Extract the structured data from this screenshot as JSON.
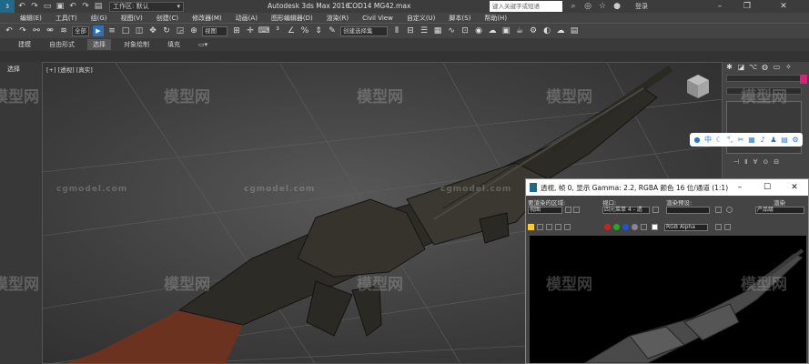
{
  "titlebar": {
    "workspace_label": "工作区: 默认",
    "app_title": "Autodesk 3ds Max 2016",
    "file_title": "COD14 MG42.max",
    "search_placeholder": "键入关键字或短语",
    "login": "登录"
  },
  "menu": [
    "编辑(E)",
    "工具(T)",
    "组(G)",
    "视图(V)",
    "创建(C)",
    "修改器(M)",
    "动画(A)",
    "图形编辑器(D)",
    "渲染(R)",
    "Civil View",
    "自定义(U)",
    "脚本(S)",
    "帮助(H)"
  ],
  "toolbar": {
    "selection_filter": "全部",
    "ref_coord": "视图",
    "named_selection": "创建选择集"
  },
  "ribbon": {
    "tabs": [
      "建模",
      "自由形式",
      "选择",
      "对象绘制",
      "填充"
    ],
    "active_tab": "选择"
  },
  "left_panel": {
    "label": "选择"
  },
  "viewport": {
    "label": "[+] [透视] [真实]"
  },
  "render_window": {
    "title": "透视, 帧 0, 显示 Gamma: 2.2, RGBA 颜色 16 位/通道 (1:1)",
    "area_to_render_label": "要渲染的区域:",
    "area_to_render_value": "视图",
    "viewport_label": "视口:",
    "viewport_value": "四元菜单 4 - 透",
    "preset_label": "渲染预设:",
    "renderer_label": "渲染",
    "renderer_value": "产品级",
    "channel_value": "RGB Alpha"
  },
  "watermark": {
    "logo_text": "模型网",
    "url_text": "cgmodel.com"
  },
  "colors": {
    "accent_blue": "#2f6fb5",
    "magenta": "#d4237a",
    "stock_wood": "#6b3220"
  }
}
